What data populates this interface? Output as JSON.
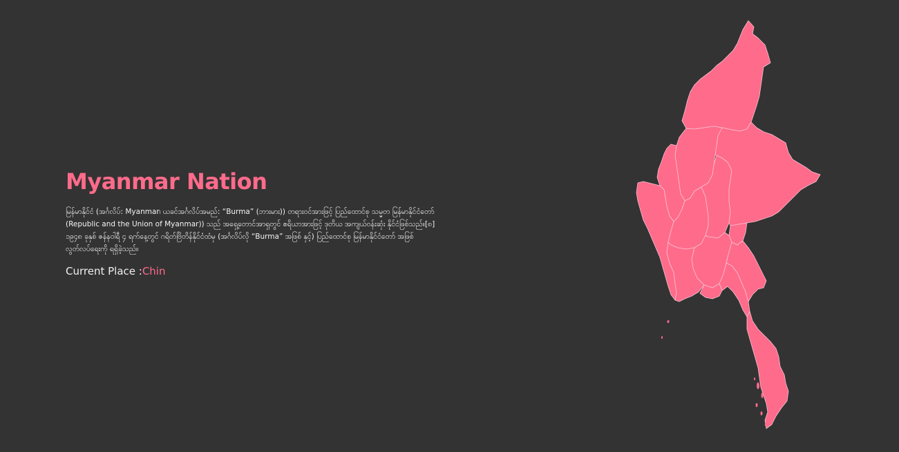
{
  "title": "Myanmar Nation",
  "description": "မြန်မာနိုင်ငံ (အင်္ဂလိပ်: Myanmar၊ ယခင်အင်္ဂလိပ်အမည်: “Burma” (ဘားမား)) တရားဝင်အားဖြင့် ပြည်ထောင်စု သမ္မတ မြန်မာနိုင်ငံတော် (Republic and the Union of Myanmar)) သည် အရှေ့တောင်အာရှတွင် ဧရိယာအားဖြင့် ဒုတိယ အကျယ်ဝန်းဆုံး နိုင်ငံဖြစ်သည်။[၈] ၁၉၄၈ ခုနှစ် ဇန်နဝါရီ ၄ ရက်နေ့တွင် ဂရိတ်ဗြိတိန်နိုင်ငံထံမှ (အင်္ဂလိပ်လို “Burma” အဖြစ် နှင့်) ပြည်ထောင်စု မြန်မာနိုင်ငံတော် အဖြစ် လွတ်လပ်ရေးကို ရရှိခဲ့သည်။",
  "current_place": {
    "label": "Current Place :",
    "value": "Chin"
  },
  "colors": {
    "background": "#333333",
    "accent": "#ff6b8b",
    "text": "#f4f4f4",
    "border": "#f7c4d2"
  }
}
